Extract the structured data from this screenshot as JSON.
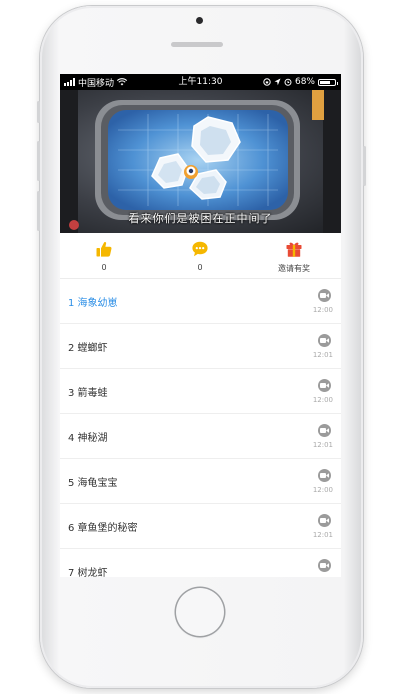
{
  "status_bar": {
    "carrier": "中国移动",
    "time": "上午11:30",
    "battery": "68%",
    "battery_level": 0.68
  },
  "video": {
    "subtitle": "看来你们是被困在正中间了"
  },
  "actions": [
    {
      "icon": "thumbs-up-icon",
      "label": "0"
    },
    {
      "icon": "comment-icon",
      "label": "0"
    },
    {
      "icon": "gift-icon",
      "label": "邀请有奖"
    }
  ],
  "episodes": [
    {
      "title": "1 海象幼崽",
      "time": "12:00",
      "active": true
    },
    {
      "title": "2 螳螂虾",
      "time": "12:01",
      "active": false
    },
    {
      "title": "3 箭毒蛙",
      "time": "12:00",
      "active": false
    },
    {
      "title": "4 神秘湖",
      "time": "12:01",
      "active": false
    },
    {
      "title": "5 海龟宝宝",
      "time": "12:00",
      "active": false
    },
    {
      "title": "6 章鱼堡的秘密",
      "time": "12:01",
      "active": false
    },
    {
      "title": "7 树龙虾",
      "time": "",
      "active": false
    }
  ],
  "colors": {
    "accent": "#2b8ee6",
    "icon_yellow": "#f5b700",
    "icon_red": "#e94b35"
  }
}
